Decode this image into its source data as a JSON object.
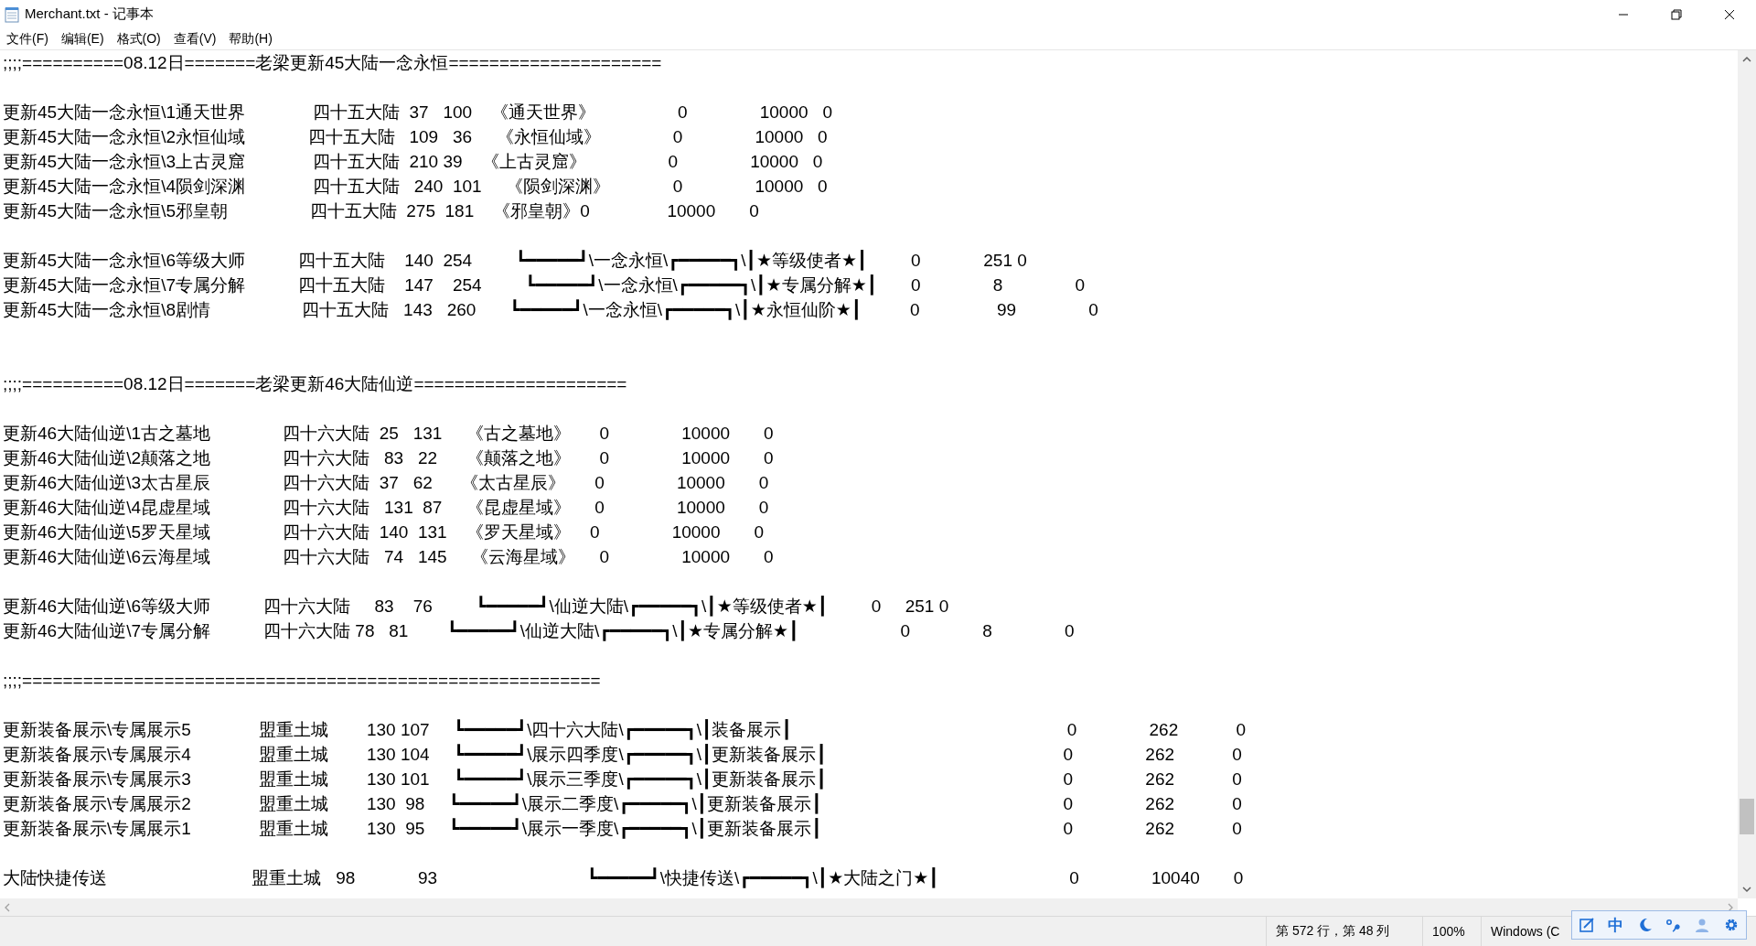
{
  "window": {
    "title": "Merchant.txt - 记事本"
  },
  "menu": [
    {
      "label": "文件(F)"
    },
    {
      "label": "编辑(E)"
    },
    {
      "label": "格式(O)"
    },
    {
      "label": "查看(V)"
    },
    {
      "label": "帮助(H)"
    }
  ],
  "editor": {
    "lines": [
      {
        "kind": "text",
        "text": ";;;;==========08.12日=======老梁更新45大陆一念永恒====================="
      },
      {
        "kind": "blank"
      },
      {
        "kind": "text",
        "text": "更新45大陆一念永恒\\1通天世界              四十五大陆  37   100    《通天世界》                 0               10000   0"
      },
      {
        "kind": "text",
        "text": "更新45大陆一念永恒\\2永恒仙域             四十五大陆   109   36     《永恒仙域》               0               10000   0"
      },
      {
        "kind": "text",
        "text": "更新45大陆一念永恒\\3上古灵窟              四十五大陆  210 39    《上古灵窟》                 0               10000   0"
      },
      {
        "kind": "text",
        "text": "更新45大陆一念永恒\\4陨剑深渊              四十五大陆   240  101     《陨剑深渊》             0               10000   0"
      },
      {
        "kind": "text",
        "text": "更新45大陆一念永恒\\5邪皇朝                 四十五大陆  275  181    《邪皇朝》0                10000       0"
      },
      {
        "kind": "blank"
      },
      {
        "kind": "text",
        "text": "更新45大陆一念永恒\\6等级大师           四十五大陆    140  254         ┗━━━━━┛\\一念永恒\\┏━━━━━┓\\┃★等级使者★┃         0             251 0"
      },
      {
        "kind": "text",
        "text": "更新45大陆一念永恒\\7专属分解           四十五大陆    147    254         ┗━━━━━┛\\一念永恒\\┏━━━━━┓\\┃★专属分解★┃       0               8               0"
      },
      {
        "kind": "text",
        "text": "更新45大陆一念永恒\\8剧情                   四十五大陆   143   260       ┗━━━━━┛\\一念永恒\\┏━━━━━┓\\┃★永恒仙阶★┃          0                99               0"
      },
      {
        "kind": "blank"
      },
      {
        "kind": "blank"
      },
      {
        "kind": "text",
        "text": ";;;;==========08.12日=======老梁更新46大陆仙逆====================="
      },
      {
        "kind": "blank"
      },
      {
        "kind": "text",
        "text": "更新46大陆仙逆\\1古之墓地               四十六大陆  25   131     《古之墓地》      0               10000       0"
      },
      {
        "kind": "text",
        "text": "更新46大陆仙逆\\2颠落之地               四十六大陆   83   22      《颠落之地》      0               10000       0"
      },
      {
        "kind": "text",
        "text": "更新46大陆仙逆\\3太古星辰               四十六大陆  37   62      《太古星辰》      0               10000       0"
      },
      {
        "kind": "text",
        "text": "更新46大陆仙逆\\4昆虚星域               四十六大陆   131  87     《昆虚星域》     0               10000       0"
      },
      {
        "kind": "text",
        "text": "更新46大陆仙逆\\5罗天星域               四十六大陆  140  131    《罗天星域》    0               10000       0"
      },
      {
        "kind": "text",
        "text": "更新46大陆仙逆\\6云海星域               四十六大陆   74   145     《云海星域》     0               10000       0"
      },
      {
        "kind": "blank"
      },
      {
        "kind": "text",
        "text": "更新46大陆仙逆\\6等级大师           四十六大陆     83    76         ┗━━━━━┛\\仙逆大陆\\┏━━━━━┓\\┃★等级使者★┃         0     251 0"
      },
      {
        "kind": "text",
        "text": "更新46大陆仙逆\\7专属分解           四十六大陆 78   81        ┗━━━━━┛\\仙逆大陆\\┏━━━━━┓\\┃★专属分解★┃                     0               8               0"
      },
      {
        "kind": "blank"
      },
      {
        "kind": "text",
        "text": ";;;;========================================================="
      },
      {
        "kind": "blank"
      },
      {
        "kind": "text",
        "text": "更新装备展示\\专属展示5              盟重土城        130 107     ┗━━━━━┛\\四十六大陆\\┏━━━━━┓\\┃装备展示┃                                                         0               262            0"
      },
      {
        "kind": "text",
        "text": "更新装备展示\\专属展示4              盟重土城        130 104     ┗━━━━━┛\\展示四季度\\┏━━━━━┓\\┃更新装备展示┃                                                 0               262            0"
      },
      {
        "kind": "text",
        "text": "更新装备展示\\专属展示3              盟重土城        130 101     ┗━━━━━┛\\展示三季度\\┏━━━━━┓\\┃更新装备展示┃                                                 0               262            0"
      },
      {
        "kind": "text",
        "text": "更新装备展示\\专属展示2              盟重土城        130  98     ┗━━━━━┛\\展示二季度\\┏━━━━━┓\\┃更新装备展示┃                                                  0               262            0"
      },
      {
        "kind": "text",
        "text": "更新装备展示\\专属展示1              盟重土城        130  95     ┗━━━━━┛\\展示一季度\\┏━━━━━┓\\┃更新装备展示┃                                                  0               262            0"
      },
      {
        "kind": "blank"
      },
      {
        "kind": "text",
        "text": "大陆快捷传送                              盟重土城   98             93                               ┗━━━━━┛\\快捷传送\\┏━━━━━┓\\┃★大陆之门★┃                           0               10040       0"
      }
    ]
  },
  "status_bar": {
    "position": "第 572 行，第 48 列",
    "zoom": "100%",
    "encoding": "Windows (C"
  },
  "ime_toolbar": {
    "mode": "中"
  }
}
